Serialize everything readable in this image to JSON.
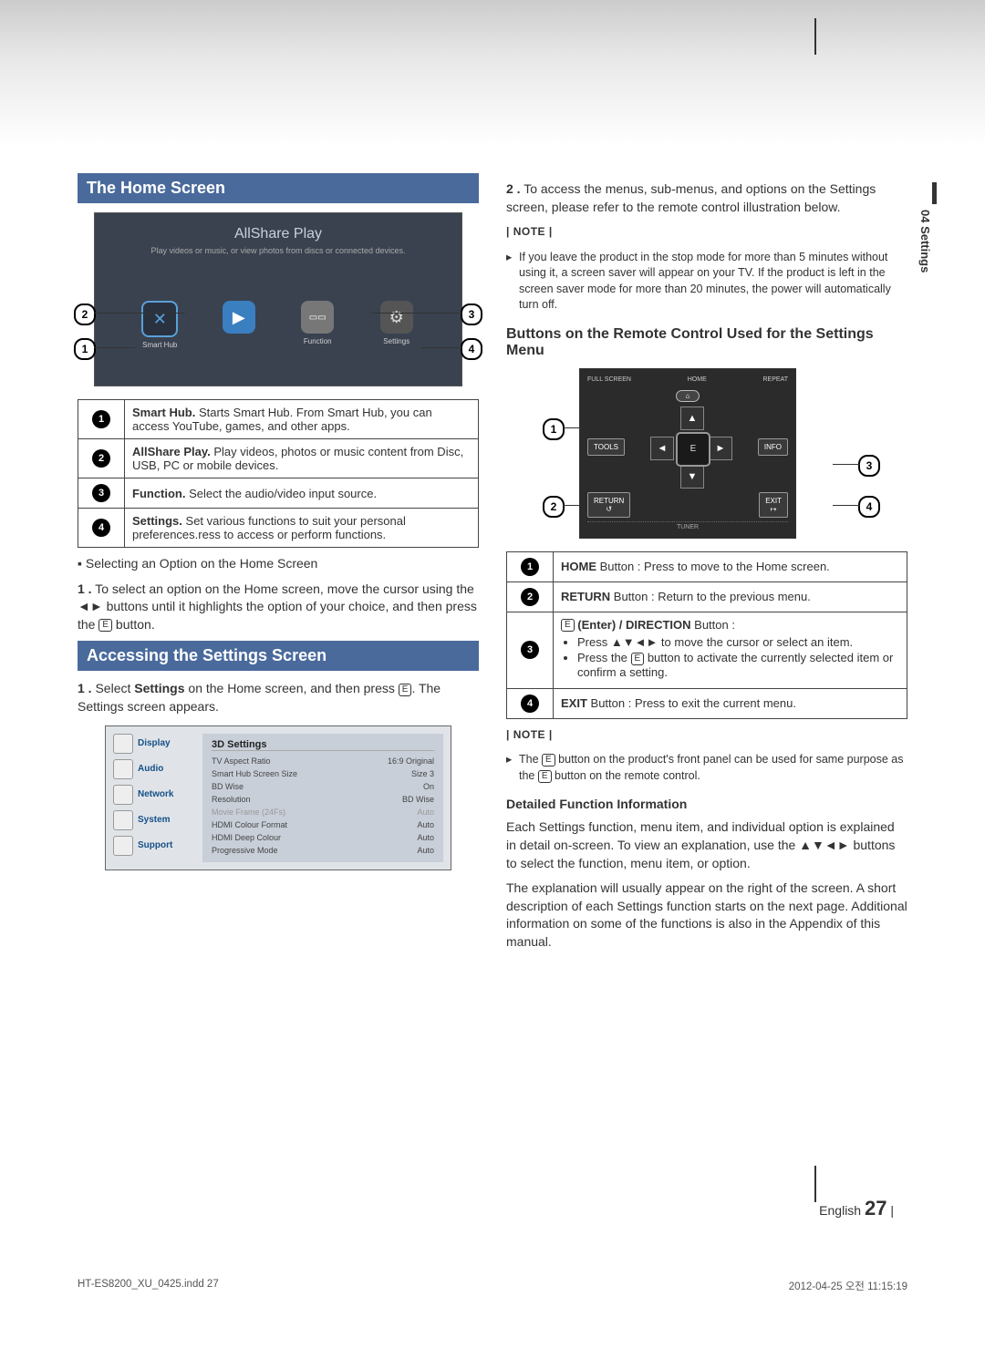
{
  "section_side": "04   Settings",
  "left": {
    "bar1": "The Home Screen",
    "allshare_title": "AllShare Play",
    "allshare_sub": "Play videos or music, or view photos from discs or connected devices.",
    "icons": {
      "smarthub": "Smart Hub",
      "play": "",
      "function": "Function",
      "settings": "Settings"
    },
    "rows": [
      {
        "n": "1",
        "title": "Smart Hub.",
        "text": " Starts Smart Hub. From Smart Hub, you can access YouTube, games, and other apps."
      },
      {
        "n": "2",
        "title": "AllShare Play.",
        "text": " Play videos, photos or music content from Disc, USB, PC or mobile devices."
      },
      {
        "n": "3",
        "title": "Function.",
        "text": " Select the audio/video input source."
      },
      {
        "n": "4",
        "title": "Settings.",
        "text": " Set various functions to suit your personal preferences.ress to access or perform functions."
      }
    ],
    "sub_bullet": "Selecting an Option on the Home Screen",
    "step1_a": "1 .",
    "step1_b": "To select an option on the Home screen, move the cursor using the ◄► buttons until it highlights the option of your choice, and then press the ",
    "step1_c": " button.",
    "bar2": "Accessing the Settings Screen",
    "step2_a": "1 .",
    "step2_b": "Select ",
    "step2_bold": "Settings",
    "step2_c": " on the Home screen, and then press ",
    "step2_d": ". The Settings screen appears.",
    "settings_sidebar": [
      "Display",
      "Audio",
      "Network",
      "System",
      "Support"
    ],
    "settings_main_title": "3D Settings",
    "settings_items": [
      {
        "k": "TV Aspect Ratio",
        "v": "16:9 Original"
      },
      {
        "k": "Smart Hub Screen Size",
        "v": "Size 3"
      },
      {
        "k": "BD Wise",
        "v": "On"
      },
      {
        "k": "Resolution",
        "v": "BD Wise"
      },
      {
        "k": "Movie Frame (24Fs)",
        "v": "Auto",
        "dim": true
      },
      {
        "k": "HDMI Colour Format",
        "v": "Auto"
      },
      {
        "k": "HDMI Deep Colour",
        "v": "Auto"
      },
      {
        "k": "Progressive Mode",
        "v": "Auto"
      }
    ]
  },
  "right": {
    "para1_a": "2 .",
    "para1_b": "To access the menus, sub-menus, and options on the Settings screen, please refer to the remote control illustration below.",
    "note_label1": "| NOTE |",
    "note1": "If you leave the product in the stop mode for more than 5 minutes without using it, a screen saver will appear on your TV. If the product is left in the screen saver mode for more than 20 minutes, the power will automatically turn off.",
    "subhead1": "Buttons on the Remote Control Used for the Settings Menu",
    "remote_labels": {
      "full": "FULL SCREEN",
      "home": "HOME",
      "repeat": "REPEAT",
      "tools": "TOOLS",
      "info": "INFO",
      "return": "RETURN",
      "exit": "EXIT",
      "tuner": "TUNER"
    },
    "rows2": [
      {
        "n": "1",
        "html": "HOME",
        "text": " Button : Press to move to the Home screen."
      },
      {
        "n": "2",
        "html": "RETURN",
        "text": " Button : Return to the previous menu."
      },
      {
        "n": "3",
        "intro": "(Enter) / DIRECTION",
        "intro2": " Button :",
        "li1": "Press ▲▼◄► to move the cursor or select an item.",
        "li2a": "Press the ",
        "li2b": " button to activate the currently selected item or confirm a setting."
      },
      {
        "n": "4",
        "html": "EXIT",
        "text": " Button : Press to exit the current menu."
      }
    ],
    "note_label2": "| NOTE |",
    "note2a": "The ",
    "note2b": " button on the product's front panel can be used for same purpose as the ",
    "note2c": " button on the remote control.",
    "subhead2": "Detailed Function Information",
    "para3": "Each Settings function, menu item, and individual option is explained in detail on-screen. To view an explanation, use the ▲▼◄► buttons to select the function, menu item, or option.",
    "para4": "The explanation will usually appear on the right of the screen. A short description of each Settings function starts on the next page. Additional information on some of the functions is also in the Appendix of this manual."
  },
  "footer": {
    "lang": "English",
    "page": "27"
  },
  "meta": {
    "file": "HT-ES8200_XU_0425.indd   27",
    "date": "2012-04-25   오전 11:15:19"
  }
}
